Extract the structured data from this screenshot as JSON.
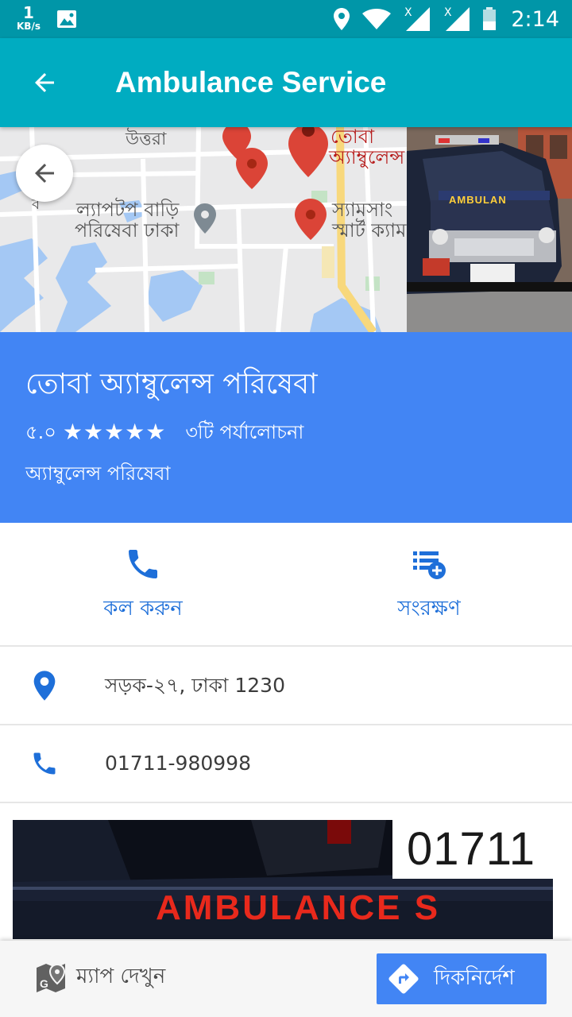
{
  "status_bar": {
    "speed_value": "1",
    "speed_unit": "KB/s",
    "time": "2:14"
  },
  "app_bar": {
    "title": "Ambulance Service"
  },
  "map": {
    "labels": {
      "uttara": "উত্তরা",
      "laptop_line1": "ল্যাপটপ বাড়ি",
      "laptop_line2": "পরিষেবা ঢাকা",
      "toba_line1": "তোবা",
      "toba_line2": "অ্যাম্বুলেন্স",
      "samsung_line1": "স্যামসাং",
      "samsung_line2": "স্মার্ট ক্যাম",
      "edge_char": "ব"
    }
  },
  "photo": {
    "vehicle_text": "AMBULAN"
  },
  "place": {
    "name": "তোবা অ্যাম্বুলেন্স পরিষেবা",
    "rating": "৫.০",
    "stars": "★★★★★",
    "reviews": "৩টি পর্যালোচনা",
    "category": "অ্যাম্বুলেন্স পরিষেবা"
  },
  "actions": {
    "call_label": "কল করুন",
    "save_label": "সংরক্ষণ"
  },
  "info": {
    "address": "সড়ক-২৭, ঢাকা 1230",
    "phone": "01711-980998"
  },
  "banner": {
    "number": "01711",
    "word": "AMBULANCE S"
  },
  "bottom_bar": {
    "view_map_label": "ম্যাপ দেখুন",
    "directions_label": "দিকনির্দেশ"
  },
  "colors": {
    "status_bar": "#0096a8",
    "app_bar": "#00acc1",
    "header_blue": "#4285f4",
    "action_blue": "#1e6fd9",
    "pin_red": "#db4437"
  }
}
